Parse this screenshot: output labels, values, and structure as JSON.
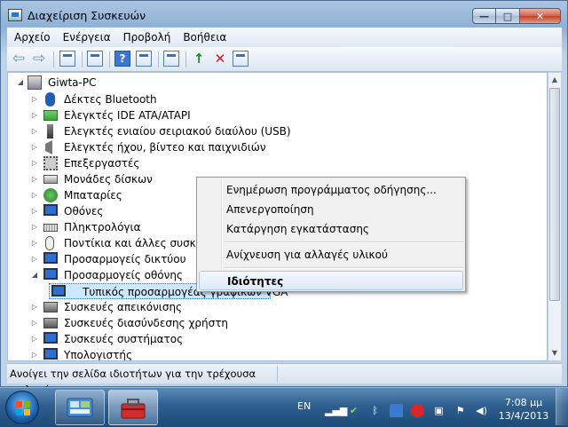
{
  "window": {
    "title": "Διαχείριση Συσκευών",
    "min_symbol": "—",
    "max_symbol": "□",
    "close_symbol": "✕"
  },
  "menu": [
    "Αρχείο",
    "Ενέργεια",
    "Προβολή",
    "Βοήθεια"
  ],
  "toolbar": {
    "back_symbol": "⇦",
    "forward_symbol": "⇨",
    "help_symbol": "?"
  },
  "tree": {
    "root": "Giwta-PC",
    "items": [
      "Δέκτες Bluetooth",
      "Ελεγκτές IDE ATA/ATAPI",
      "Ελεγκτές ενιαίου σειριακού διαύλου (USB)",
      "Ελεγκτές ήχου, βίντεο και παιχνιδιών",
      "Επεξεργαστές",
      "Μονάδες δίσκων",
      "Μπαταρίες",
      "Οθόνες",
      "Πληκτρολόγια",
      "Ποντίκια και άλλες συσκευές κατάδειξης",
      "Προσαρμογείς δικτύου",
      "Προσαρμογείς οθόνης",
      "Τυπικός προσαρμογέας γραφικών VGA",
      "Συσκευές απεικόνισης",
      "Συσκευές διασύνδεσης χρήστη",
      "Συσκευές συστήματος",
      "Υπολογιστής"
    ]
  },
  "context_menu": {
    "items": [
      "Ενημέρωση προγράμματος οδήγησης...",
      "Απενεργοποίηση",
      "Κατάργηση εγκατάστασης",
      "Ανίχνευση για αλλαγές υλικού",
      "Ιδιότητες"
    ],
    "highlighted": "Ιδιότητες"
  },
  "status": {
    "text": "Ανοίγει την σελίδα ιδιοτήτων για την τρέχουσα επιλογή."
  },
  "taskbar": {
    "language": "EN",
    "time": "7:08 μμ",
    "date": "13/4/2013"
  },
  "colors": {
    "selection": "#cce8ff",
    "taskbar": "#2e5f8f",
    "menu_highlight": "#dde9f8"
  }
}
